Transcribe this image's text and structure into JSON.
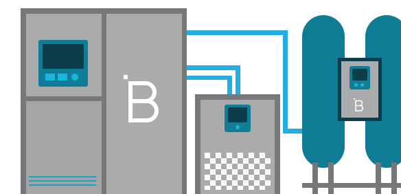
{
  "colors": {
    "cabinet_frame": "#76787a",
    "panel": "#a9abad",
    "screen_frame": "#117e97",
    "screen": "#0c3d4b",
    "accent": "#19b6df",
    "pipe": "#22aee3",
    "tank": "#0f7c95",
    "logo": "#ffffff"
  },
  "icons": {
    "main_logo": "b-logo-icon",
    "small_logo": "b-logo-icon",
    "grille": "vent-grille-icon"
  }
}
